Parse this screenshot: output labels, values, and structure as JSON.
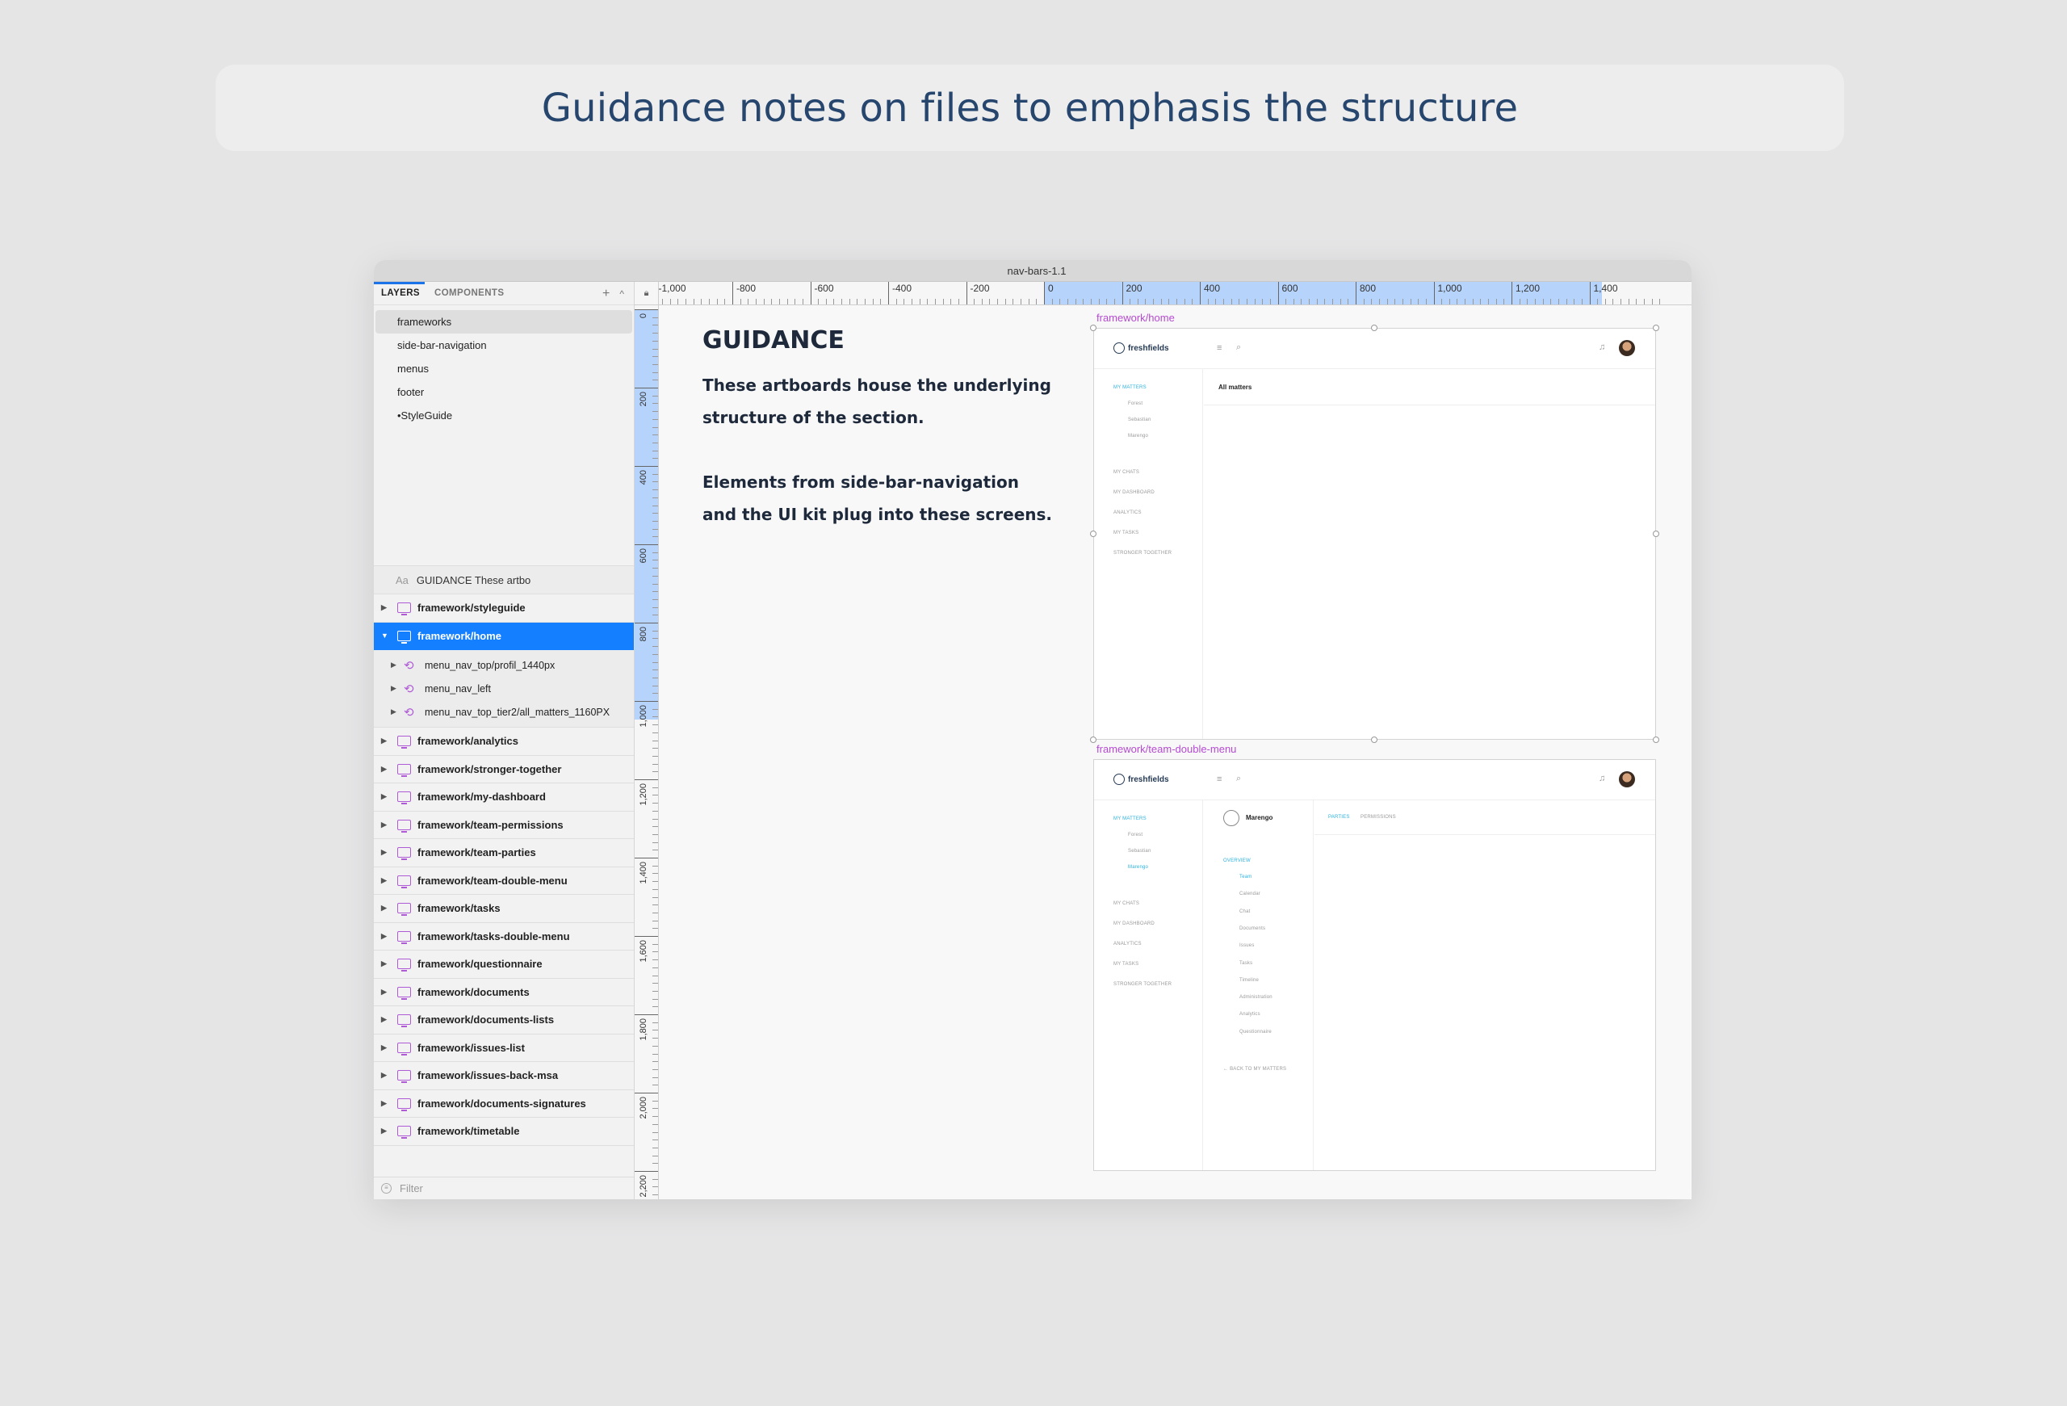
{
  "banner": {
    "title": "Guidance notes on files to emphasis the structure"
  },
  "window": {
    "title": "nav-bars-1.1"
  },
  "sidebar": {
    "tabs": [
      {
        "label": "LAYERS"
      },
      {
        "label": "COMPONENTS"
      }
    ],
    "add_symbol": "+",
    "collapse_symbol": "^",
    "pages": [
      {
        "label": "frameworks"
      },
      {
        "label": "side-bar-navigation"
      },
      {
        "label": "menus"
      },
      {
        "label": "footer"
      },
      {
        "label": "•StyleGuide"
      }
    ],
    "text_layer": {
      "icon": "Aa",
      "label": "GUIDANCE These artbo"
    },
    "layers_before": [
      {
        "label": "framework/styleguide"
      }
    ],
    "selected_layer": {
      "label": "framework/home"
    },
    "children": [
      {
        "label": "menu_nav_top/profil_1440px"
      },
      {
        "label": "menu_nav_left"
      },
      {
        "label": "menu_nav_top_tier2/all_matters_1160PX"
      }
    ],
    "layers_after": [
      {
        "label": "framework/analytics"
      },
      {
        "label": "framework/stronger-together"
      },
      {
        "label": "framework/my-dashboard"
      },
      {
        "label": "framework/team-permissions"
      },
      {
        "label": "framework/team-parties"
      },
      {
        "label": "framework/team-double-menu"
      },
      {
        "label": "framework/tasks"
      },
      {
        "label": "framework/tasks-double-menu"
      },
      {
        "label": "framework/questionnaire"
      },
      {
        "label": "framework/documents"
      },
      {
        "label": "framework/documents-lists"
      },
      {
        "label": "framework/issues-list"
      },
      {
        "label": "framework/issues-back-msa"
      },
      {
        "label": "framework/documents-signatures"
      },
      {
        "label": "framework/timetable"
      }
    ],
    "filter_placeholder": "Filter"
  },
  "rulers": {
    "horizontal": [
      "-1,000",
      "-800",
      "-600",
      "-400",
      "-200",
      "0",
      "200",
      "400",
      "600",
      "800",
      "1,000",
      "1,200",
      "1,400"
    ],
    "vertical": [
      "0",
      "200",
      "400",
      "600",
      "800",
      "1,000",
      "1,200",
      "1,400",
      "1,600",
      "1,800",
      "2,000",
      "2,200"
    ]
  },
  "guidance": {
    "heading": "GUIDANCE",
    "paragraph1": "These artboards house the underlying structure of the section.",
    "paragraph2": "Elements from side-bar-navigation and the UI kit plug into these screens."
  },
  "artboard_home": {
    "label": "framework/home",
    "logo": "freshfields",
    "menu_icon": "≡",
    "content_title": "All matters",
    "nav_primary": "MY MATTERS",
    "nav_matters": [
      "Forest",
      "Sebastian",
      "Marengo"
    ],
    "nav_secondary": [
      "MY CHATS",
      "MY DASHBOARD",
      "ANALYTICS",
      "MY TASKS",
      "STRONGER TOGETHER"
    ]
  },
  "artboard_team": {
    "label": "framework/team-double-menu",
    "logo": "freshfields",
    "menu_icon": "≡",
    "nav_primary": "MY MATTERS",
    "nav_matters": [
      "Forest",
      "Sebastian",
      "Marengo"
    ],
    "nav_secondary": [
      "MY CHATS",
      "MY DASHBOARD",
      "ANALYTICS",
      "MY TASKS",
      "STRONGER TOGETHER"
    ],
    "matter_name": "Marengo",
    "overview_label": "OVERVIEW",
    "overview_items": [
      "Team",
      "Calendar",
      "Chat",
      "Documents",
      "Issues",
      "Tasks",
      "Timeline",
      "Administration",
      "Analytics",
      "Questionnaire"
    ],
    "back_link": "← BACK TO MY MATTERS",
    "tabs": [
      "PARTIES",
      "PERMISSIONS"
    ]
  },
  "colors": {
    "accent": "#1580ff",
    "artboard_label": "#b64ad3",
    "banner_text": "#27466e",
    "nav_highlight": "#2ab2df"
  }
}
